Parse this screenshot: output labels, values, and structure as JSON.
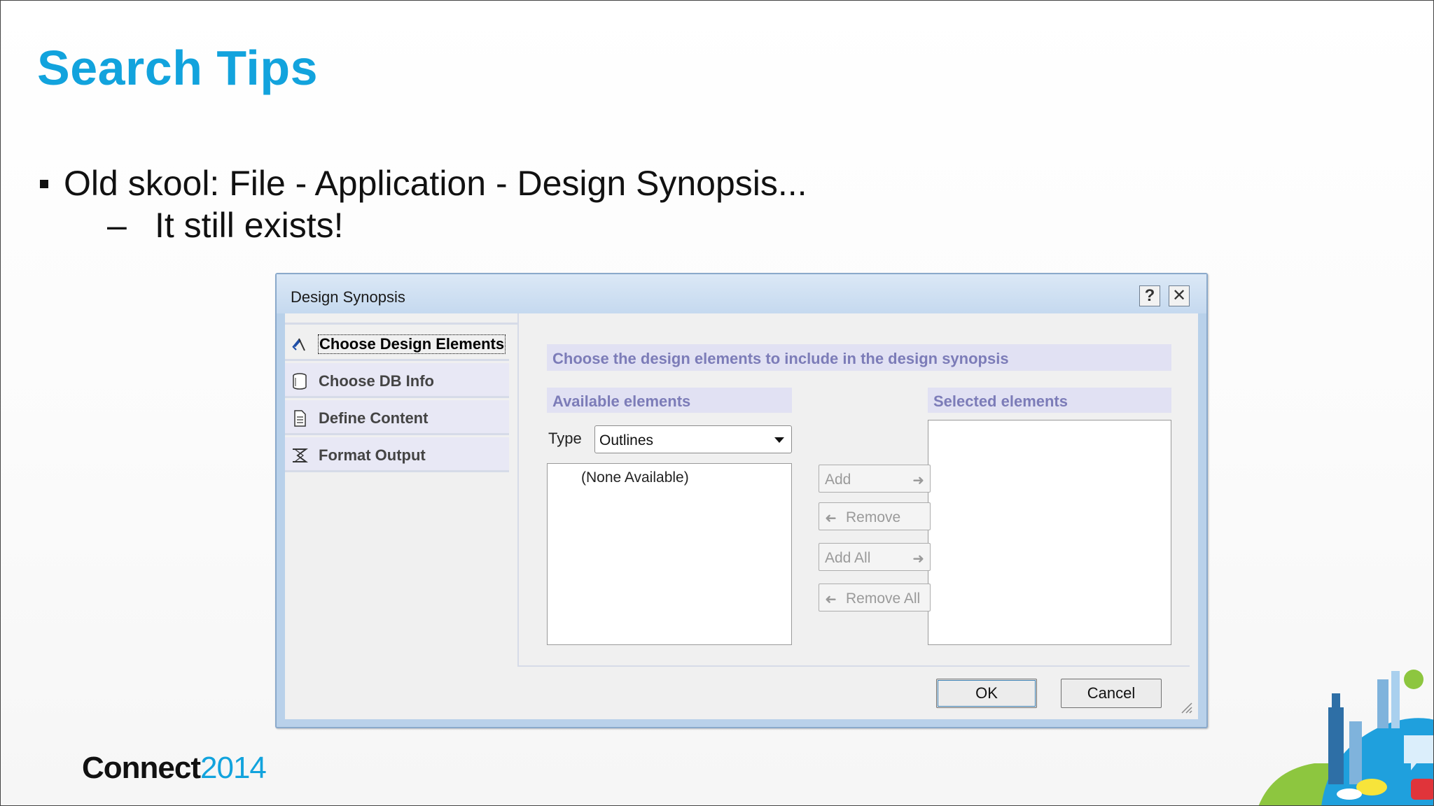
{
  "slide": {
    "title": "Search Tips",
    "bullet": "Old skool:  File - Application - Design Synopsis...",
    "sub_bullet": "It still exists!",
    "sub_bullet_marker": "–"
  },
  "dialog": {
    "title": "Design Synopsis",
    "help_label": "?",
    "close_label": "✕",
    "nav": [
      {
        "label": "Choose Design Elements",
        "icon": "design-elements-icon",
        "active": true
      },
      {
        "label": "Choose DB Info",
        "icon": "database-icon",
        "active": false
      },
      {
        "label": "Define Content",
        "icon": "document-icon",
        "active": false
      },
      {
        "label": "Format Output",
        "icon": "format-icon",
        "active": false
      }
    ],
    "instruction": "Choose the design elements to include in the design synopsis",
    "available_header": "Available elements",
    "selected_header": "Selected elements",
    "type_label": "Type",
    "type_value": "Outlines",
    "available_items": [
      "(None Available)"
    ],
    "selected_items": [],
    "move_buttons": {
      "add": "Add",
      "remove": "Remove",
      "add_all": "Add All",
      "remove_all": "Remove All"
    },
    "ok_label": "OK",
    "cancel_label": "Cancel"
  },
  "branding": {
    "name": "Connect",
    "year": "2014"
  },
  "colors": {
    "title_blue": "#12a3dd",
    "dialog_frame": "#b9d1ea",
    "band": "#e1e1f3",
    "band_text": "#7c7cb8"
  }
}
